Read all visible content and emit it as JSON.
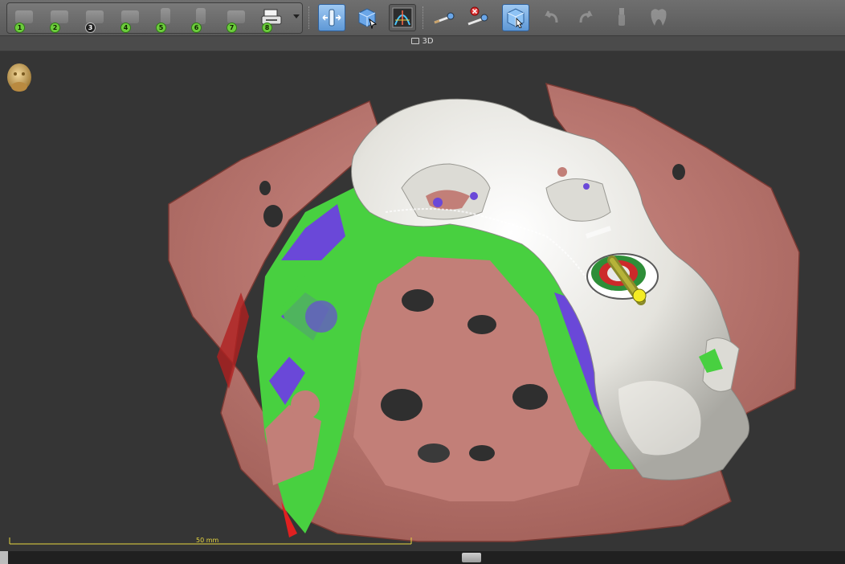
{
  "toolbar": {
    "workflow_steps": [
      {
        "number": "1",
        "icon": "patient-data-icon"
      },
      {
        "number": "2",
        "icon": "panorama-curve-icon"
      },
      {
        "number": "3",
        "icon": "prosthetic-plan-icon"
      },
      {
        "number": "4",
        "icon": "nerve-canal-icon"
      },
      {
        "number": "5",
        "icon": "implant-icon"
      },
      {
        "number": "6",
        "icon": "sleeve-icon"
      },
      {
        "number": "7",
        "icon": "guide-design-icon"
      },
      {
        "number": "8",
        "icon": "print-export-icon"
      }
    ],
    "tools": [
      {
        "icon": "implant-alignment-icon",
        "active": true
      },
      {
        "icon": "select-object-icon",
        "active": false
      },
      {
        "icon": "panoramic-view-icon",
        "active": false
      },
      {
        "icon": "measure-distance-icon",
        "active": false
      },
      {
        "icon": "delete-measurement-icon",
        "active": false
      },
      {
        "icon": "3d-cube-select-icon",
        "active": true
      },
      {
        "icon": "undo-icon",
        "active": false
      },
      {
        "icon": "redo-icon",
        "active": false
      },
      {
        "icon": "implant-model-icon",
        "active": false
      },
      {
        "icon": "tooth-icon",
        "active": false
      }
    ],
    "colors": {
      "active": "#5e98d6",
      "step_badge": "#6ccc3c"
    }
  },
  "view": {
    "title": "3D",
    "orientation_icon": "head-orientation-icon",
    "scale_label": "50 mm"
  },
  "scene": {
    "colors": {
      "bone": "#c07a72",
      "guide": "#e7e6e0",
      "soft_tissue": "#48d040",
      "nerve_overlay": "#6a48d8",
      "drill_sleeve": "#e6e030",
      "background": "#353535"
    }
  }
}
